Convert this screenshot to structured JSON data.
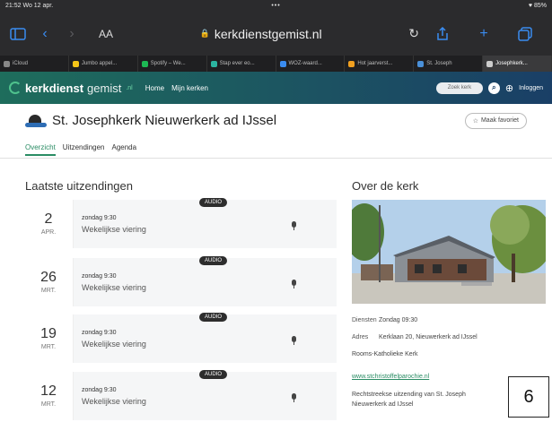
{
  "status_bar": {
    "time": "21:52  Wo 12 apr.",
    "dots": "•••",
    "battery": "♥ 85%"
  },
  "browser": {
    "text_size_label": "AA",
    "url": "kerkdienstgemist.nl",
    "icons": [
      "sidebar-icon",
      "back-icon",
      "forward-icon",
      "reload-icon",
      "share-icon",
      "new-tab-icon",
      "tabs-icon"
    ]
  },
  "tabs": [
    {
      "label": "iCloud",
      "color": "#888888"
    },
    {
      "label": "Jumbo appel...",
      "color": "#f5c518"
    },
    {
      "label": "Spotify – We...",
      "color": "#1db954"
    },
    {
      "label": "Stap ever eo...",
      "color": "#2bb4a0"
    },
    {
      "label": "WOZ-waard...",
      "color": "#3a8cf0"
    },
    {
      "label": "Hot jaarverst...",
      "color": "#f0a020"
    },
    {
      "label": "St. Joseph",
      "color": "#4a90d9"
    },
    {
      "label": "Josephkerk...",
      "color": "#cccccc"
    }
  ],
  "site": {
    "logo_bold": "kerkdienst",
    "logo_light": "gemist",
    "logo_tld": ".nl",
    "nav": [
      "Home",
      "Mijn kerken"
    ],
    "search_placeholder": "Zoek kerk",
    "login": "Inloggen"
  },
  "church": {
    "name": "St. Josephkerk Nieuwerkerk ad IJssel",
    "favorite_label": "Maak favoriet",
    "subnav": [
      "Overzicht",
      "Uitzendingen",
      "Agenda"
    ]
  },
  "broadcasts": {
    "title": "Laatste uitzendingen",
    "items": [
      {
        "day": "2",
        "month": "APR.",
        "time": "zondag 9:30",
        "desc": "Wekelijkse viering",
        "badge": "AUDIO"
      },
      {
        "day": "26",
        "month": "MRT.",
        "time": "zondag 9:30",
        "desc": "Wekelijkse viering",
        "badge": "AUDIO"
      },
      {
        "day": "19",
        "month": "MRT.",
        "time": "zondag 9:30",
        "desc": "Wekelijkse viering",
        "badge": "AUDIO"
      },
      {
        "day": "12",
        "month": "MRT.",
        "time": "zondag 9:30",
        "desc": "Wekelijkse viering",
        "badge": "AUDIO"
      }
    ]
  },
  "about": {
    "title": "Over de kerk",
    "services_label": "Diensten",
    "services_value": "Zondag 09:30",
    "address_label": "Adres",
    "address_value": "Kerklaan 20, Nieuwerkerk ad IJssel",
    "denomination": "Rooms-Katholieke Kerk",
    "link": "www.stchristoffelparochie.nl",
    "description_line1": "Rechtstreekse uitzending van St. Joseph",
    "description_line2": "Nieuwerkerk ad IJssel"
  },
  "page_number": "6"
}
